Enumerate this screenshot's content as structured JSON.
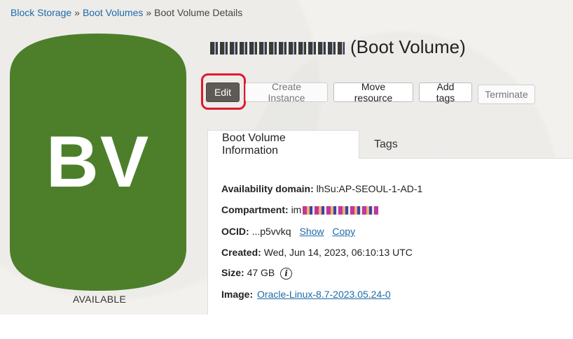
{
  "breadcrumb": {
    "items": [
      "Block Storage",
      "Boot Volumes",
      "Boot Volume Details"
    ],
    "separator": "»"
  },
  "volume": {
    "badge": "BV",
    "status": "AVAILABLE",
    "title_suffix": "(Boot Volume)",
    "color": "#4d7f2b"
  },
  "actions": {
    "edit": "Edit",
    "create_instance": "Create Instance",
    "move_resource": "Move resource",
    "add_tags": "Add tags",
    "terminate": "Terminate"
  },
  "tabs": {
    "info": "Boot Volume Information",
    "tags": "Tags"
  },
  "info": {
    "availability_label": "Availability domain:",
    "availability_value": "lhSu:AP-SEOUL-1-AD-1",
    "compartment_label": "Compartment:",
    "compartment_value": "im",
    "ocid_label": "OCID:",
    "ocid_value": "...p5vvkq",
    "show": "Show",
    "copy": "Copy",
    "created_label": "Created:",
    "created_value": "Wed, Jun 14, 2023, 06:10:13 UTC",
    "size_label": "Size:",
    "size_value": "47 GB",
    "image_label": "Image:",
    "image_value": "Oracle-Linux-8.7-2023.05.24-0"
  },
  "icons": {
    "info": "info-circle-icon"
  }
}
